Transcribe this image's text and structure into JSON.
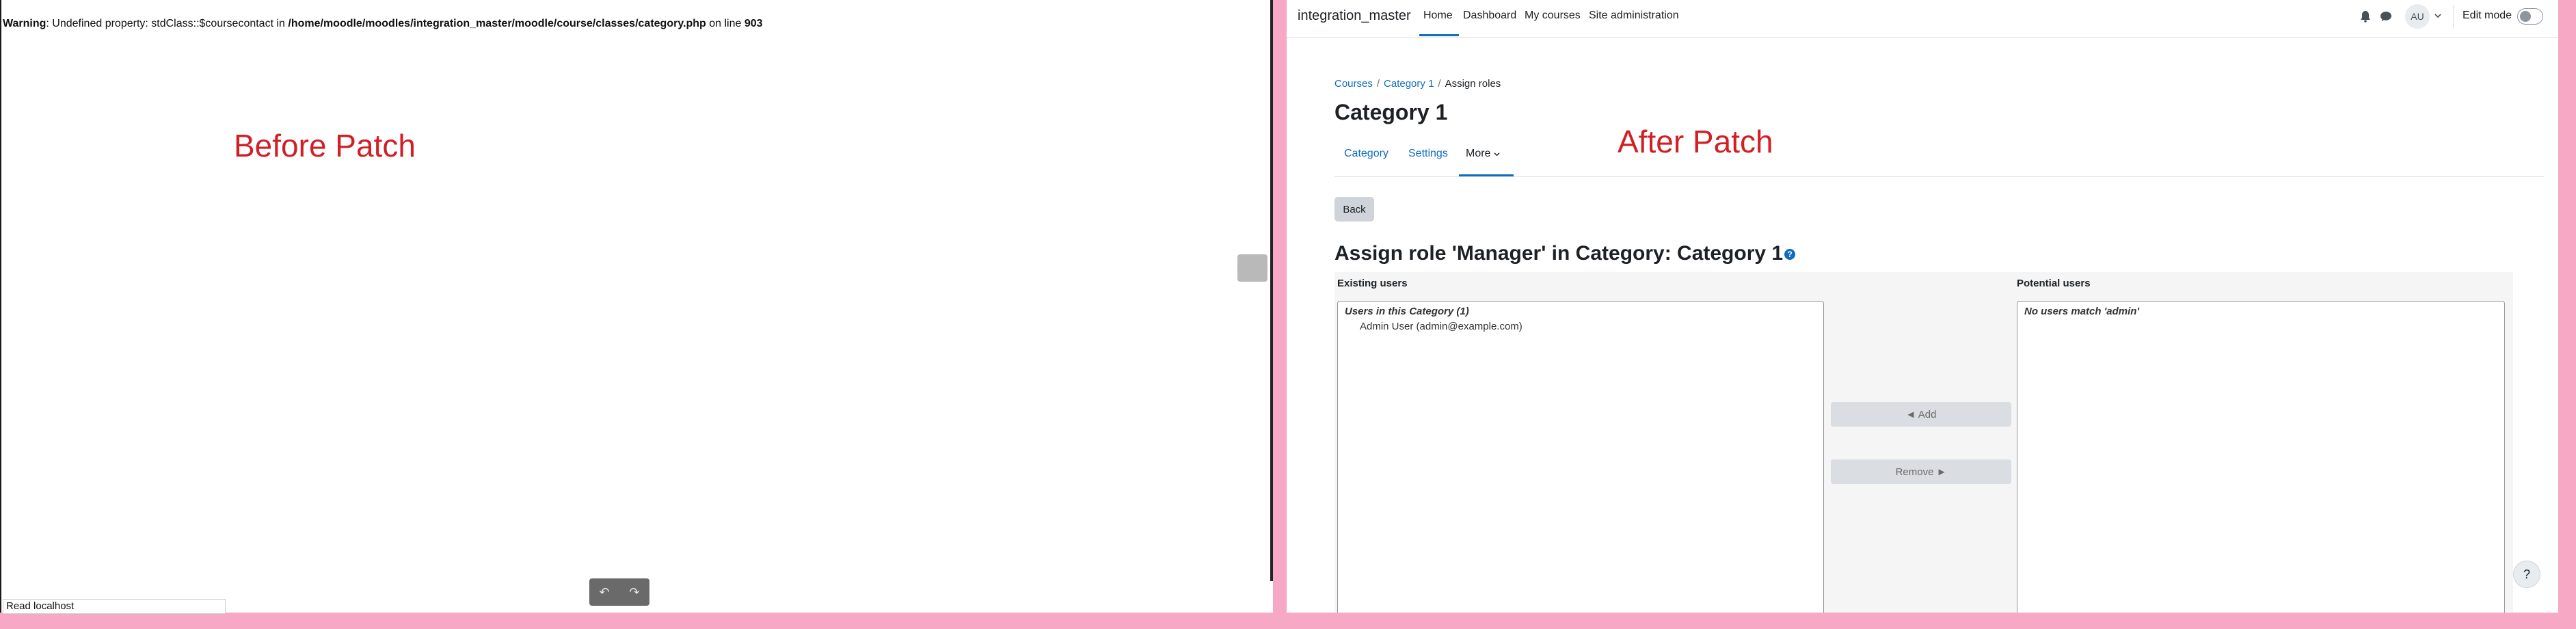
{
  "left_panel": {
    "warning_prefix": "Warning",
    "warning_text": ": Undefined property: stdClass::$coursecontact in ",
    "warning_path": "/home/moodle/moodles/integration_master/moodle/course/classes/category.php",
    "warning_online": " on line ",
    "warning_line": "903",
    "label": "Before Patch",
    "status_bar": "Read localhost",
    "undo_icon": "↶",
    "redo_icon": "↷"
  },
  "right_panel": {
    "navbar": {
      "site_name": "integration_master",
      "links": [
        "Home",
        "Dashboard",
        "My courses",
        "Site administration"
      ],
      "avatar_initials": "AU",
      "edit_mode_label": "Edit mode"
    },
    "label": "After Patch",
    "breadcrumb": [
      "Courses",
      "Category 1",
      "Assign roles"
    ],
    "page_title": "Category 1",
    "tabs": [
      "Category",
      "Settings",
      "More"
    ],
    "back_label": "Back",
    "assign_heading": "Assign role 'Manager' in Category: Category 1",
    "existing": {
      "label": "Existing users",
      "group": "Users in this Category (1)",
      "entries": [
        "Admin User (admin@example.com)"
      ]
    },
    "potential": {
      "label": "Potential users",
      "group": "No users match 'admin'"
    },
    "add_label": "◄ Add",
    "remove_label": "Remove ►",
    "help_fab": "?"
  },
  "colors": {
    "accent": "#0f6cbf",
    "annotation_red": "#d21f26",
    "frame_pink": "#f7a8c4"
  }
}
